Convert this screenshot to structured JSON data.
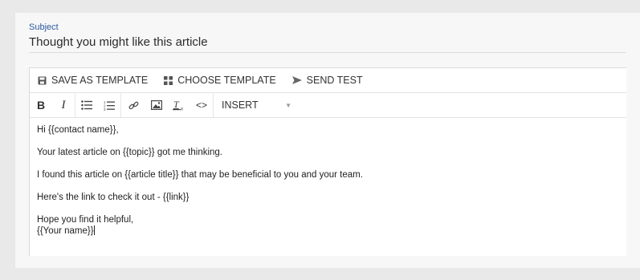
{
  "subject": {
    "label": "Subject",
    "value": "Thought you might like this article"
  },
  "toolbar": {
    "save_template": "SAVE AS TEMPLATE",
    "choose_template": "CHOOSE TEMPLATE",
    "send_test": "SEND TEST",
    "insert": "INSERT",
    "icons": [
      "bold-icon",
      "italic-icon",
      "bulleted-list-icon",
      "numbered-list-icon",
      "link-icon",
      "image-icon",
      "clear-format-icon",
      "code-icon"
    ]
  },
  "body": {
    "greeting": "Hi {{contact name}},",
    "line1": "Your latest article on {{topic}} got me thinking.",
    "line2": "I found this article on {{article title}} that may be beneficial to you and your team.",
    "line3": "Here's the link to check it out - {{link}}",
    "closing": "Hope you find it helpful,",
    "signature": "{{Your name}}"
  },
  "colors": {
    "accent": "#2c5aa0",
    "background": "#e9e9e9"
  }
}
